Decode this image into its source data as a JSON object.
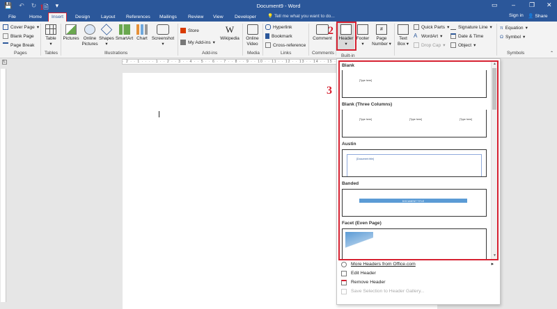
{
  "window": {
    "title": "Document9 - Word",
    "signin": "Sign in",
    "share": "Share"
  },
  "qat": {
    "save": "💾",
    "undo": "↶",
    "redo": "↻",
    "new": "🗎",
    "more": "▾"
  },
  "tabs": [
    "File",
    "Home",
    "Insert",
    "Design",
    "Layout",
    "References",
    "Mailings",
    "Review",
    "View",
    "Developer"
  ],
  "tellme": "Tell me what you want to do...",
  "groups": {
    "pages": {
      "label": "Pages",
      "cover": "Cover Page",
      "blank": "Blank Page",
      "break": "Page Break"
    },
    "tables": {
      "label": "Tables",
      "table": "Table"
    },
    "illustrations": {
      "label": "Illustrations",
      "pictures": "Pictures",
      "online_pictures": "Online Pictures",
      "shapes": "Shapes",
      "smartart": "SmartArt",
      "chart": "Chart",
      "screenshot": "Screenshot"
    },
    "addins": {
      "label": "Add-ins",
      "store": "Store",
      "my_addins": "My Add-ins",
      "wikipedia": "Wikipedia"
    },
    "media": {
      "label": "Media",
      "online_video": "Online Video"
    },
    "links": {
      "label": "Links",
      "hyperlink": "Hyperlink",
      "bookmark": "Bookmark",
      "crossref": "Cross-reference"
    },
    "comments": {
      "label": "Comments",
      "comment": "Comment"
    },
    "headerfooter": {
      "header": "Header",
      "footer": "Footer",
      "page_number": "Page Number"
    },
    "text": {
      "textbox": "Text Box",
      "quickparts": "Quick Parts",
      "wordart": "WordArt",
      "dropcap": "Drop Cap",
      "sigline": "Signature Line",
      "datetime": "Date & Time",
      "object": "Object"
    },
    "symbols": {
      "label": "Symbols",
      "equation": "Equation",
      "symbol": "Symbol"
    }
  },
  "builtin_label": "Built-in",
  "gallery": [
    {
      "name": "Blank",
      "ph": "[Type here]"
    },
    {
      "name": "Blank (Three Columns)",
      "ph1": "[Type here]",
      "ph2": "[Type here]",
      "ph3": "[Type here]"
    },
    {
      "name": "Austin",
      "ph": "[Document title]"
    },
    {
      "name": "Banded",
      "ph": "DOCUMENT TITLE"
    },
    {
      "name": "Facet (Even Page)"
    }
  ],
  "menu": {
    "more": "More Headers from Office.com",
    "edit": "Edit Header",
    "remove": "Remove Header",
    "save": "Save Selection to Header Gallery..."
  },
  "steps": {
    "one": "1",
    "two": "2",
    "three": "3"
  },
  "ruler_text": "· 2 · · 1 · · · · 1 · · 2 · · 3 · · 4 · · 5 · · 6 · · 7 · · 8 · · 9 · · 10 · · 11 · · 12 · · 13 · · 14 · · 15 · · 16 · · 17 · · 18"
}
